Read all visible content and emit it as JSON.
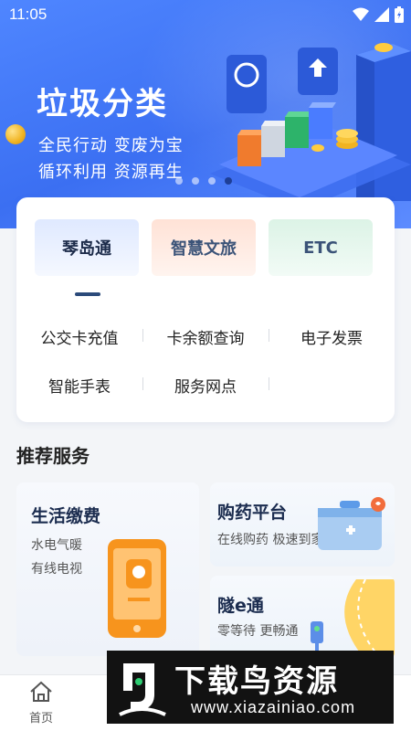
{
  "status_bar": {
    "time": "11:05"
  },
  "banner": {
    "title": "垃圾分类",
    "subtitle_1": "全民行动 变废为宝",
    "subtitle_2": "循环利用 资源再生",
    "carousel_total": 4,
    "carousel_active": 4
  },
  "service_tabs": [
    {
      "label": "琴岛通",
      "active": true
    },
    {
      "label": "智慧文旅",
      "active": false
    },
    {
      "label": "ETC",
      "active": false
    }
  ],
  "quick_links": [
    "公交卡充值",
    "卡余额查询",
    "电子发票",
    "智能手表",
    "服务网点"
  ],
  "section_title": "推荐服务",
  "recommend": {
    "card1": {
      "title": "生活缴费",
      "line1": "水电气暖",
      "line2": "有线电视"
    },
    "card2": {
      "title": "购药平台",
      "desc": "在线购药 极速到家"
    },
    "card3": {
      "title": "隧e通",
      "desc": "零等待 更畅通"
    }
  },
  "bottom_nav": {
    "home_label": "首页"
  },
  "watermark": {
    "brand": "下载鸟资源",
    "url": "www.xiazainiao.com"
  },
  "colors": {
    "primary": "#3b6ff2",
    "accent_orange": "#f7941d",
    "text_dark": "#1b2c4f"
  }
}
